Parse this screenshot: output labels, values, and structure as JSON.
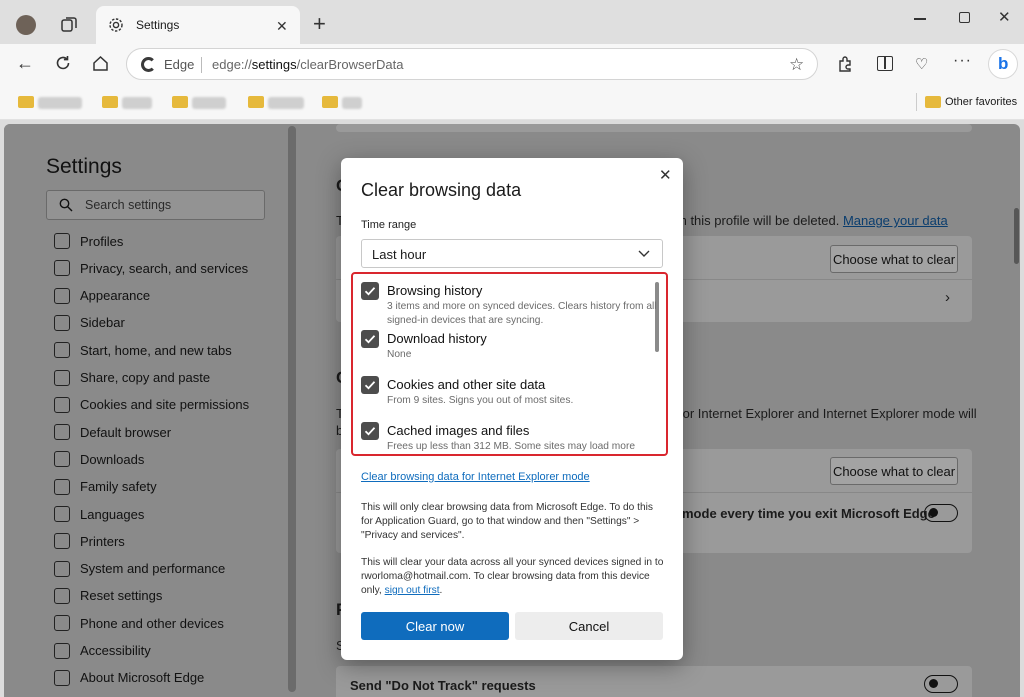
{
  "browser": {
    "tab_title": "Settings",
    "address_scheme": "Edge",
    "address_url_prefix": "edge://",
    "address_url_host": "settings",
    "address_url_path": "/clearBrowserData",
    "other_favorites": "Other favorites"
  },
  "sidebar": {
    "title": "Settings",
    "search_placeholder": "Search settings",
    "items": [
      {
        "label": "Profiles",
        "icon": "profile-icon"
      },
      {
        "label": "Privacy, search, and services",
        "icon": "lock-icon"
      },
      {
        "label": "Appearance",
        "icon": "appearance-icon"
      },
      {
        "label": "Sidebar",
        "icon": "sidebar-icon"
      },
      {
        "label": "Start, home, and new tabs",
        "icon": "home-icon"
      },
      {
        "label": "Share, copy and paste",
        "icon": "share-icon"
      },
      {
        "label": "Cookies and site permissions",
        "icon": "cookie-icon"
      },
      {
        "label": "Default browser",
        "icon": "browser-icon"
      },
      {
        "label": "Downloads",
        "icon": "download-icon"
      },
      {
        "label": "Family safety",
        "icon": "family-icon"
      },
      {
        "label": "Languages",
        "icon": "language-icon"
      },
      {
        "label": "Printers",
        "icon": "printer-icon"
      },
      {
        "label": "System and performance",
        "icon": "system-icon"
      },
      {
        "label": "Reset settings",
        "icon": "reset-icon"
      },
      {
        "label": "Phone and other devices",
        "icon": "phone-icon"
      },
      {
        "label": "Accessibility",
        "icon": "accessibility-icon"
      },
      {
        "label": "About Microsoft Edge",
        "icon": "edge-icon"
      }
    ]
  },
  "content": {
    "heading1_fragment": "C",
    "line1_left": "T",
    "line1_right": "m this profile will be deleted.",
    "manage_link": "Manage your data",
    "choose_button_1": "Choose what to clear",
    "heading2_fragment": "C",
    "line2_right": "for Internet Explorer and Internet Explorer mode will",
    "line2_left2": "b",
    "choose_button_2": "Choose what to clear",
    "ie_mode_text": "mode every time you exit Microsoft Edge",
    "heading3_fragment": "P",
    "line3_left": "S",
    "do_not_track": "Send \"Do Not Track\" requests"
  },
  "dialog": {
    "title": "Clear browsing data",
    "time_range_label": "Time range",
    "time_range_value": "Last hour",
    "items": [
      {
        "title": "Browsing history",
        "desc": "3 items and more on synced devices. Clears history from all signed-in devices that are syncing.",
        "checked": true
      },
      {
        "title": "Download history",
        "desc": "None",
        "checked": true
      },
      {
        "title": "Cookies and other site data",
        "desc": "From 9 sites. Signs you out of most sites.",
        "checked": true
      },
      {
        "title": "Cached images and files",
        "desc": "Frees up less than 312 MB. Some sites may load more",
        "checked": true
      }
    ],
    "ie_link": "Clear browsing data for Internet Explorer mode",
    "info1": "This will only clear browsing data from Microsoft Edge. To do this for Application Guard, go to that window and then \"Settings\" > \"Privacy and services\".",
    "info2_prefix": "This will clear your data across all your synced devices signed in to rworloma@hotmail.com. To clear browsing data from this device only,",
    "sign_out_link": "sign out first",
    "info2_suffix": ".",
    "clear_button": "Clear now",
    "cancel_button": "Cancel"
  },
  "colors": {
    "accent": "#0f6cbd",
    "highlight_border": "#d9262e",
    "checkbox": "#4d4d4d"
  }
}
